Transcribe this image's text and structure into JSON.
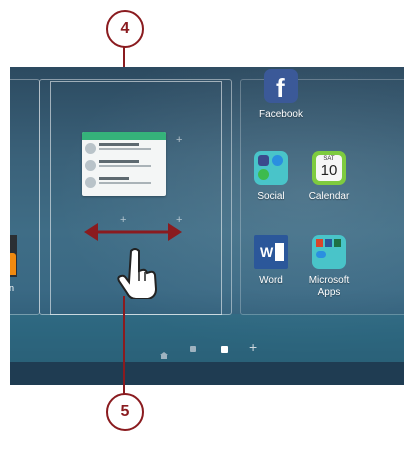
{
  "callouts": {
    "step_top": "4",
    "step_bottom": "5"
  },
  "apps": {
    "facebook": "Facebook",
    "social": "Social",
    "calendar": "Calendar",
    "calendar_day": "SAT",
    "calendar_date": "10",
    "word": "Word",
    "microsoft_apps": "Microsoft Apps",
    "edge_app_label": "n"
  },
  "page_indicator": [
    "home",
    "page",
    "page-current",
    "add"
  ],
  "colors": {
    "callout": "#8a1b1f",
    "widget_header": "#35b27a",
    "facebook": "#3b5998",
    "word": "#2b579a"
  },
  "icons": [
    "facebook-icon",
    "social-folder-icon",
    "calendar-icon",
    "word-icon",
    "microsoft-apps-folder-icon",
    "hand-pointer-icon",
    "double-arrow-icon",
    "home-dot-icon",
    "add-page-icon"
  ]
}
